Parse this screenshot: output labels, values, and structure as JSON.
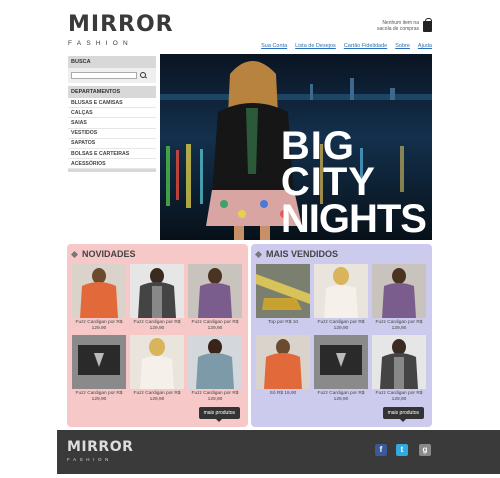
{
  "brand": {
    "name": "MIRROR",
    "tagline": "FASHION"
  },
  "cart": {
    "line1": "Nenhum item na",
    "line2": "sacola de compras",
    "icon": "shopping-bag-icon"
  },
  "topnav": [
    "Sua Conta",
    "Lista de Desejos",
    "Cartão Fidelidade",
    "Sobre",
    "Ajuda"
  ],
  "sidebar": {
    "search_label": "BUSCA",
    "search_placeholder": "",
    "departments_label": "DEPARTAMENTOS",
    "departments": [
      "Blusas e Camisas",
      "Calças",
      "Saias",
      "Vestidos",
      "Sapatos",
      "Bolsas e Carteiras",
      "Acessórios"
    ]
  },
  "hero": {
    "line1": "BIG",
    "line2": "CITY",
    "line3": "NIGHTS"
  },
  "novidades": {
    "title": "NOVIDADES",
    "products": [
      {
        "caption1": "Fuzz Cardigan por R$",
        "caption2": "129,90"
      },
      {
        "caption1": "Fuzz Cardigan por R$",
        "caption2": "129,90"
      },
      {
        "caption1": "Fuzz Cardigan por R$",
        "caption2": "129,90"
      },
      {
        "caption1": "Fuzz Cardigan por R$",
        "caption2": "129,90"
      },
      {
        "caption1": "Fuzz Cardigan por R$",
        "caption2": "129,90"
      },
      {
        "caption1": "Fuzz Cardigan por R$",
        "caption2": "129,90"
      }
    ],
    "more_label": "mais produtos"
  },
  "mais_vendidos": {
    "title": "MAIS VENDIDOS",
    "products": [
      {
        "caption1": "Top por R$ 10",
        "caption2": ""
      },
      {
        "caption1": "Fuzz Cardigan por R$",
        "caption2": "129,90"
      },
      {
        "caption1": "Fuzz Cardigan por R$",
        "caption2": "129,90"
      },
      {
        "caption1": "Só R$ 19,90",
        "caption2": ""
      },
      {
        "caption1": "Fuzz Cardigan por R$",
        "caption2": "129,90"
      },
      {
        "caption1": "Fuzz Cardigan por R$",
        "caption2": "129,90"
      }
    ],
    "more_label": "mais produtos"
  },
  "footer": {
    "name": "MIRROR",
    "tagline": "FASHION",
    "social": [
      "f",
      "t",
      "g"
    ]
  },
  "colors": {
    "novidades_bg": "#f6c9c8",
    "vendidos_bg": "#cccbee",
    "footer_bg": "#3a3a3a",
    "link": "#2a6fb8"
  }
}
